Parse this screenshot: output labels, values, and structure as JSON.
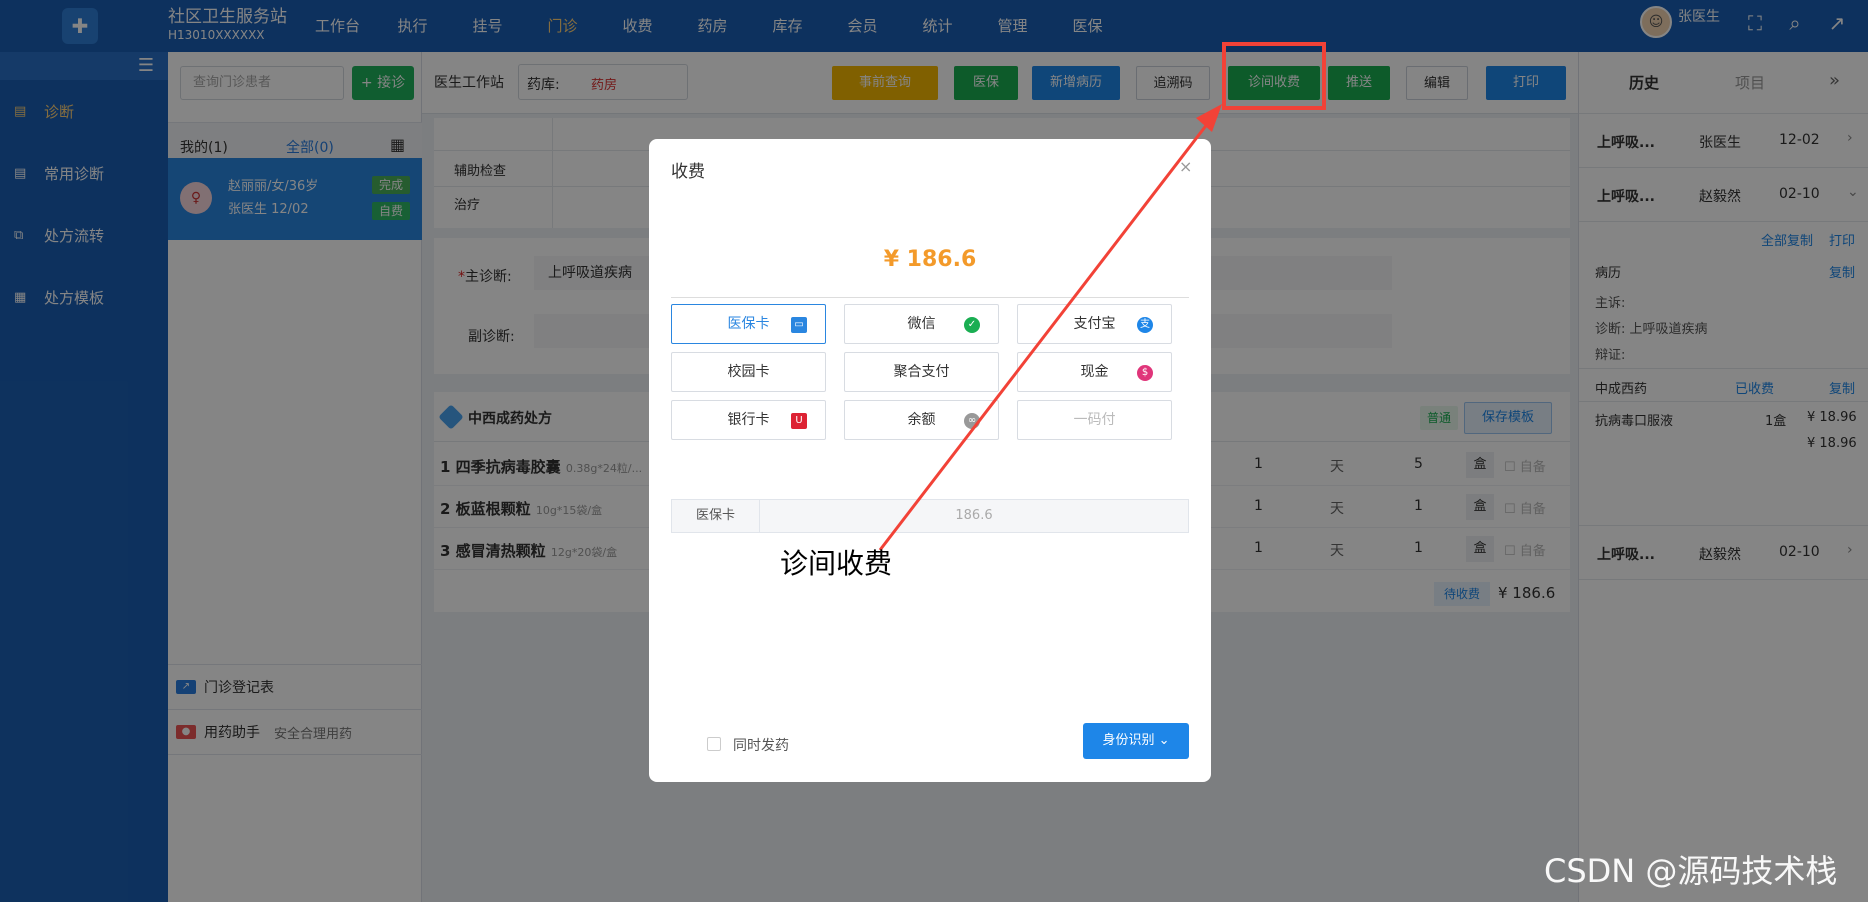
{
  "topbar": {
    "station_name": "社区卫生服务站",
    "station_code": "H13010XXXXXX",
    "nav": [
      "工作台",
      "执行",
      "挂号",
      "门诊",
      "收费",
      "药房",
      "库存",
      "会员",
      "统计",
      "管理",
      "医保"
    ],
    "active_nav": "门诊",
    "user": "张医生",
    "icons": [
      "fullscreen-icon",
      "search-icon",
      "external-link-icon"
    ]
  },
  "sidebar": {
    "items": [
      {
        "label": "诊断",
        "icon": "document-icon",
        "active": true
      },
      {
        "label": "常用诊断",
        "icon": "file-icon",
        "active": false
      },
      {
        "label": "处方流转",
        "icon": "flow-icon",
        "active": false
      },
      {
        "label": "处方模板",
        "icon": "template-icon",
        "active": false
      }
    ]
  },
  "patients": {
    "search_placeholder": "查询门诊患者",
    "receive_label": "+ 接诊",
    "mine_label": "我的(1)",
    "all_label": "全部(0)",
    "card": {
      "name": "赵丽丽/女/36岁",
      "doctor": "张医生   12/02",
      "tag1": "完成",
      "tag2": "自费"
    },
    "tools": [
      {
        "label": "门诊登记表",
        "sub": ""
      },
      {
        "label": "用药助手",
        "sub": "安全合理用药"
      }
    ]
  },
  "toolbar": {
    "title": "医生工作站",
    "pharmacy_label": "药库:",
    "pharmacy_value": "药房",
    "buttons": [
      "事前查询",
      "医保",
      "新增病历",
      "追溯码",
      "诊间收费",
      "推送",
      "编辑",
      "打印"
    ]
  },
  "record": {
    "labels": [
      "辅助检查",
      "治疗"
    ]
  },
  "diagnosis": {
    "main_label": "主诊断:",
    "main_value": "上呼吸道疾病",
    "sub_label": "副诊断:"
  },
  "prescription": {
    "title": "中西成药处方",
    "tag": "普通",
    "save_template": "保存模板",
    "drugs": [
      {
        "idx": "1",
        "name": "四季抗病毒胶囊",
        "spec": "0.38g*24粒/...",
        "qty": "1",
        "unit": "天",
        "amount": "5",
        "pack": "盒",
        "self": "自备"
      },
      {
        "idx": "2",
        "name": "板蓝根颗粒",
        "spec": "10g*15袋/盒",
        "qty": "1",
        "unit": "天",
        "amount": "1",
        "pack": "盒",
        "self": "自备"
      },
      {
        "idx": "3",
        "name": "感冒清热颗粒",
        "spec": "12g*20袋/盒",
        "qty": "1",
        "unit": "天",
        "amount": "1",
        "pack": "盒",
        "self": "自备"
      }
    ],
    "status": "待收费",
    "total": "¥ 186.6"
  },
  "right_panel": {
    "tab_history": "历史",
    "tab_items": "项目",
    "history": [
      {
        "diag": "上呼吸...",
        "doctor": "张医生",
        "date": "12-02"
      },
      {
        "diag": "上呼吸...",
        "doctor": "赵毅然",
        "date": "02-10"
      },
      {
        "diag": "上呼吸...",
        "doctor": "赵毅然",
        "date": "02-10"
      }
    ],
    "copy_all": "全部复制",
    "print": "打印",
    "record_label": "病历",
    "copy": "复制",
    "complaint": "主诉:",
    "diagnosis": "诊断:  上呼吸道疾病",
    "syndrome": "辩证:",
    "med_label": "中成西药",
    "med_status": "已收费",
    "med_name": "抗病毒口服液",
    "med_qty": "1盒",
    "med_price": "¥ 18.96",
    "med_total": "¥ 18.96"
  },
  "modal": {
    "title": "收费",
    "amount": "¥ 186.6",
    "methods": [
      "医保卡",
      "微信",
      "支付宝",
      "校园卡",
      "聚合支付",
      "现金",
      "银行卡",
      "余额",
      "一码付"
    ],
    "selected_method": "医保卡",
    "pay_line_label": "医保卡",
    "pay_line_value": "186.6",
    "dispense_label": "同时发药",
    "id_button": "身份识别"
  },
  "annotation": {
    "text": "诊间收费",
    "color": "#f24237"
  },
  "watermark": "CSDN @源码技术栈"
}
